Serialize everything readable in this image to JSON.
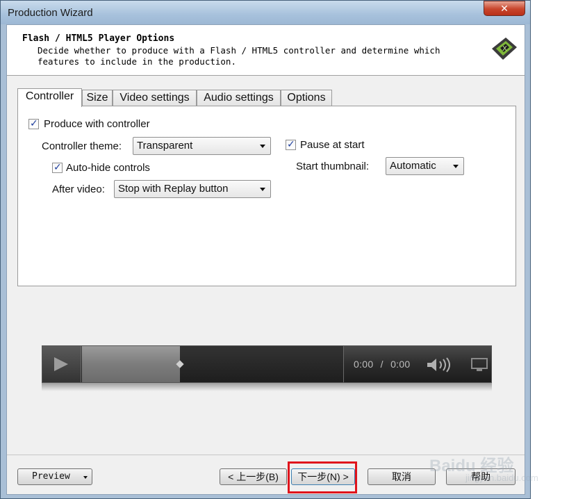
{
  "window": {
    "title": "Production Wizard",
    "close_glyph": "✕"
  },
  "header": {
    "title": "Flash / HTML5 Player Options",
    "description_line1": "Decide whether to produce with a Flash / HTML5 controller and determine which",
    "description_line2": "features to include in the production.",
    "logo_icon": "camtasia-logo-icon"
  },
  "tabs": [
    {
      "label": "Controller",
      "active": true
    },
    {
      "label": "Size",
      "active": false
    },
    {
      "label": "Video settings",
      "active": false
    },
    {
      "label": "Audio settings",
      "active": false
    },
    {
      "label": "Options",
      "active": false
    }
  ],
  "controller": {
    "produce_with_controller": {
      "label": "Produce with controller",
      "checked": true
    },
    "controller_theme": {
      "label": "Controller theme:",
      "value": "Transparent"
    },
    "auto_hide": {
      "label": "Auto-hide controls",
      "checked": true
    },
    "after_video": {
      "label": "After video:",
      "value": "Stop with Replay button"
    },
    "pause_at_start": {
      "label": "Pause at start",
      "checked": true
    },
    "start_thumbnail": {
      "label": "Start thumbnail:",
      "value": "Automatic"
    }
  },
  "player_preview": {
    "time_current": "0:00",
    "time_separator": "/",
    "time_total": "0:00",
    "seek_progress": 0.375,
    "play_icon": "play-icon",
    "volume_icon": "volume-icon",
    "fullscreen_icon": "screen-icon"
  },
  "footer": {
    "preview_label": "Preview",
    "back_label": "< 上一步(B)",
    "next_label": "下一步(N) >",
    "cancel_label": "取消",
    "help_label": "帮助"
  },
  "watermark": {
    "text": "Baidu 经验",
    "sub": "jingyan.baidu.com"
  },
  "colors": {
    "highlight_box": "#e0141c",
    "checkmark": "#1f3f9e",
    "close_button": "#c8452c"
  }
}
